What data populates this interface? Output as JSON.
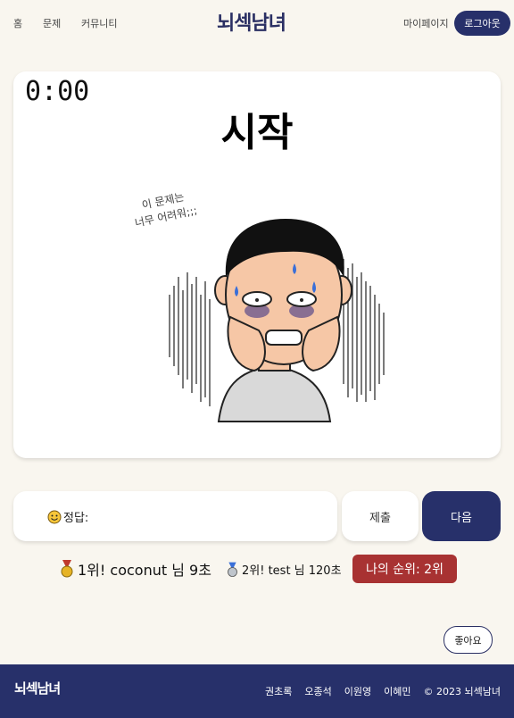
{
  "header": {
    "nav": [
      "홈",
      "문제",
      "커뮤니티"
    ],
    "logo": "뇌섹남녀",
    "mypage_label": "마이페이지",
    "logout_label": "로그아웃"
  },
  "quiz": {
    "timer": "0:00",
    "title": "시작",
    "speech_line1": "이 문제는",
    "speech_line2": "너무 어려워;;;"
  },
  "answer": {
    "label": "정답:",
    "value": "",
    "placeholder": "",
    "submit_label": "제출",
    "next_label": "다음"
  },
  "ranking": {
    "first": "1위! coconut 님 9초",
    "second": "2위! test 님 120초",
    "mine": "나의 순위: 2위"
  },
  "like_label": "좋아요",
  "footer": {
    "logo": "뇌섹남녀",
    "names": [
      "권초록",
      "오종석",
      "이원영",
      "이혜민"
    ],
    "copyright": "© 2023 뇌섹남녀"
  },
  "colors": {
    "primary": "#27306a",
    "background": "#f9f6ef",
    "rank_badge": "#a83232"
  }
}
